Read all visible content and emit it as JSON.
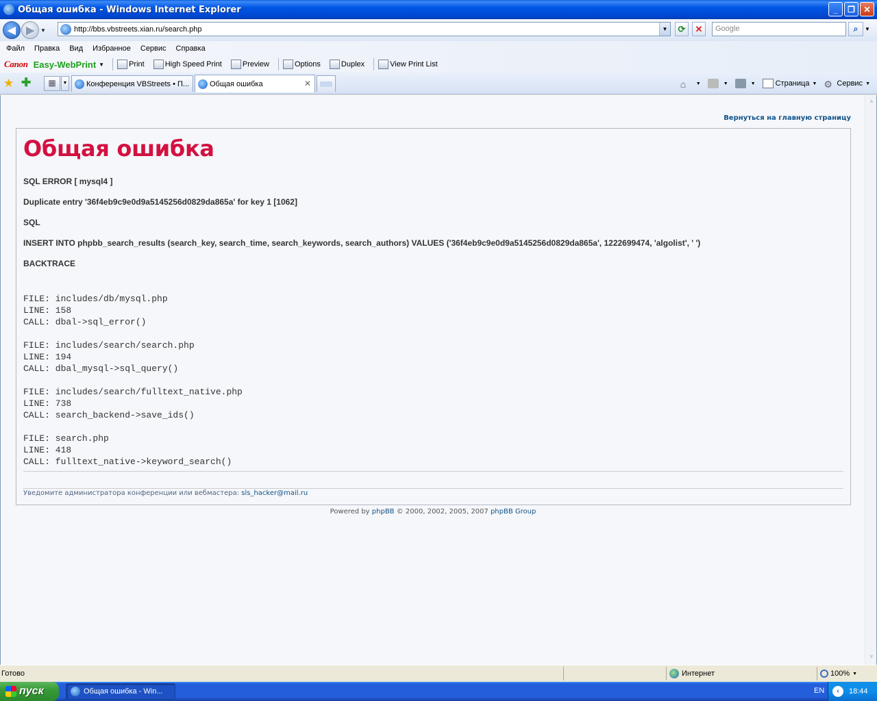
{
  "window": {
    "title": "Общая ошибка - Windows Internet Explorer"
  },
  "address": {
    "url": "http://bbs.vbstreets.xian.ru/search.php",
    "search_placeholder": "Google"
  },
  "menu": [
    "Файл",
    "Правка",
    "Вид",
    "Избранное",
    "Сервис",
    "Справка"
  ],
  "canon_toolbar": {
    "brand": "Canon",
    "product": "Easy-WebPrint",
    "items": [
      "Print",
      "High Speed Print",
      "Preview",
      "Options",
      "Duplex",
      "View Print List"
    ]
  },
  "tabs": [
    {
      "label": "Конференция VBStreets • П...",
      "active": false
    },
    {
      "label": "Общая ошибка",
      "active": true
    }
  ],
  "command_bar": {
    "page": "Страница",
    "tools": "Сервис"
  },
  "page": {
    "back_link": "Вернуться на главную страницу",
    "title": "Общая ошибка",
    "sql_error": "SQL ERROR [ mysql4 ]",
    "duplicate": "Duplicate entry '36f4eb9c9e0d9a5145256d0829da865a' for key 1 [1062]",
    "sql_label": "SQL",
    "sql_query": "INSERT INTO phpbb_search_results (search_key, search_time, search_keywords, search_authors) VALUES ('36f4eb9c9e0d9a5145256d0829da865a', 1222699474, 'algolist', ' ')",
    "backtrace_label": "BACKTRACE",
    "backtrace": "FILE: includes/db/mysql.php\nLINE: 158\nCALL: dbal->sql_error()\n\nFILE: includes/search/search.php\nLINE: 194\nCALL: dbal_mysql->sql_query()\n\nFILE: includes/search/fulltext_native.php\nLINE: 738\nCALL: search_backend->save_ids()\n\nFILE: search.php\nLINE: 418\nCALL: fulltext_native->keyword_search()",
    "notice_text": "Уведомите администратора конференции или вебмастера: ",
    "notice_email": "sls_hacker@mail.ru",
    "powered_prefix": "Powered by ",
    "powered_phpbb": "phpBB",
    "powered_mid": " © 2000, 2002, 2005, 2007 ",
    "powered_group": "phpBB Group"
  },
  "status": {
    "text": "Готово",
    "zone": "Интернет",
    "zoom": "100%"
  },
  "taskbar": {
    "start": "пуск",
    "item": "Общая ошибка - Win...",
    "lang": "EN",
    "clock": "18:44"
  }
}
